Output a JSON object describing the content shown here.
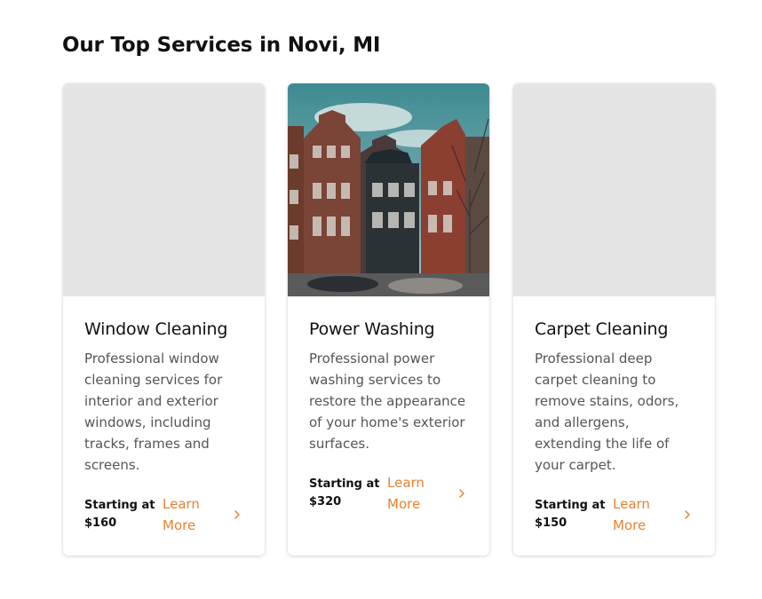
{
  "section": {
    "heading": "Our Top Services in Novi, MI"
  },
  "services": [
    {
      "title": "Window Cleaning",
      "description": "Professional window cleaning services for interior and exterior windows, including tracks, frames and screens.",
      "price_label": "Starting at $160",
      "cta_label": "Learn More",
      "image": "placeholder"
    },
    {
      "title": "Power Washing",
      "description": "Professional power washing services to restore the appearance of your home's exterior surfaces.",
      "price_label": "Starting at $320",
      "cta_label": "Learn More",
      "image": "photo-of-row-houses-with-parked-cars"
    },
    {
      "title": "Carpet Cleaning",
      "description": "Professional deep carpet cleaning to remove stains, odors, and allergens, extending the life of your carpet.",
      "price_label": "Starting at $150",
      "cta_label": "Learn More",
      "image": "placeholder"
    }
  ],
  "colors": {
    "accent": "#e98232",
    "placeholder": "#e5e5e5",
    "text": "#111111",
    "muted_text": "#555555"
  },
  "icons": {
    "cta": "chevron-right-icon"
  }
}
